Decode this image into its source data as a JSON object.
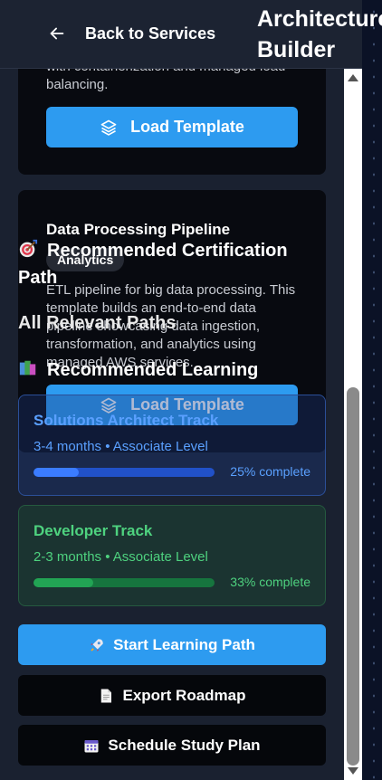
{
  "header": {
    "back_label": "Back to Services",
    "title_line1": "Architecture",
    "title_line2": "Builder"
  },
  "templates": [
    {
      "description": "with containerization and managed load balancing.",
      "button_label": "Load Template"
    },
    {
      "title": "Data Processing Pipeline",
      "badge": "Analytics",
      "description": "ETL pipeline for big data processing. This template builds an end-to-end data pipeline showcasing data ingestion, transformation, and analytics using managed AWS services.",
      "button_label": "Load Template"
    }
  ],
  "certification": {
    "heading_line1": "Recommended Certification",
    "heading_line2": "Path",
    "subheading": "All Relevant Paths",
    "learning_heading": "Recommended Learning"
  },
  "tracks": [
    {
      "name": "Solutions Architect Track",
      "meta": "3-4 months • Associate Level",
      "progress": 25,
      "progress_label": "25% complete"
    },
    {
      "name": "Developer Track",
      "meta": "2-3 months • Associate Level",
      "progress": 33,
      "progress_label": "33% complete"
    }
  ],
  "actions": {
    "start": "Start Learning Path",
    "export": "Export Roadmap",
    "schedule": "Schedule Study Plan"
  },
  "icons": {
    "back": "arrow-left-icon",
    "layers": "layers-icon",
    "target": "target-icon",
    "books": "books-icon",
    "rocket": "rocket-icon",
    "document": "document-icon",
    "calendar": "calendar-icon"
  },
  "colors": {
    "accent": "#2d9bf0",
    "architect_track": "#5aa0ff",
    "developer_track": "#4ed27f"
  }
}
